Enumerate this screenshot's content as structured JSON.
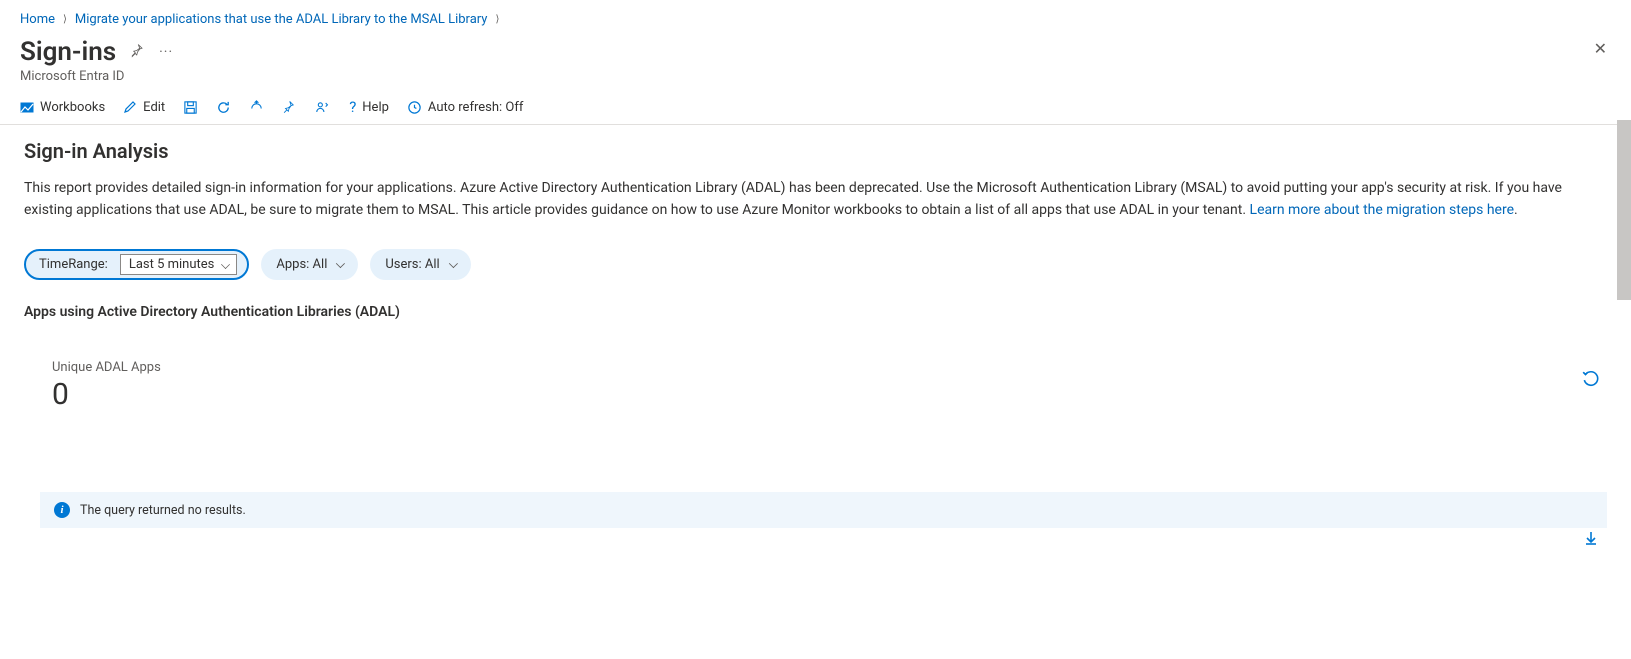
{
  "breadcrumb": {
    "home": "Home",
    "migrate": "Migrate your applications that use the ADAL Library to the MSAL Library"
  },
  "header": {
    "title": "Sign-ins",
    "subtitle": "Microsoft Entra ID"
  },
  "toolbar": {
    "workbooks": "Workbooks",
    "edit": "Edit",
    "help": "Help",
    "auto_refresh": "Auto refresh: Off"
  },
  "section": {
    "title": "Sign-in Analysis",
    "description": "This report provides detailed sign-in information for your applications. Azure Active Directory Authentication Library (ADAL) has been deprecated. Use the Microsoft Authentication Library (MSAL) to avoid putting your app's security at risk. If you have existing applications that use ADAL, be sure to migrate them to MSAL. This article provides guidance on how to use Azure Monitor workbooks to obtain a list of all apps that use ADAL in your tenant. ",
    "learn_more": "Learn more about the migration steps here"
  },
  "filters": {
    "time_label": "TimeRange:",
    "time_value": "Last 5 minutes",
    "apps": "Apps: All",
    "users": "Users: All"
  },
  "subsection": {
    "label": "Apps using Active Directory Authentication Libraries (ADAL)",
    "metric_title": "Unique ADAL Apps",
    "metric_value": "0"
  },
  "info_bar": {
    "text": "The query returned no results."
  }
}
